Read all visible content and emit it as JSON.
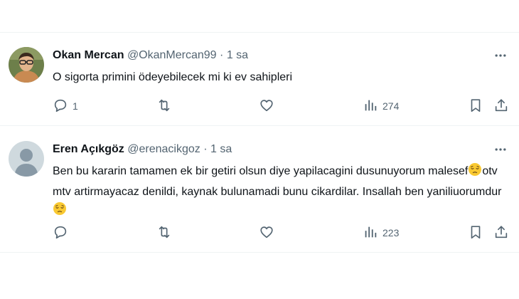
{
  "tweets": [
    {
      "name": "Okan Mercan",
      "handle": "@OkanMercan99",
      "dot": "·",
      "time": "1 sa",
      "text": "O sigorta primini ödeyebilecek mi ki ev sahipleri",
      "reply_count": "1",
      "retweet_count": "",
      "like_count": "",
      "views_count": "274"
    },
    {
      "name": "Eren Açıkgöz",
      "handle": "@erenacikgoz",
      "dot": "·",
      "time": "1 sa",
      "text_part1": "Ben bu kararin tamamen ek bir getiri olsun diye yapilacagini dusunuyorum malesef",
      "text_part2": "otv mtv artirmayacaz denildi, kaynak bulunamadi bunu cikardilar. Insallah ben yaniliuorumdur",
      "reply_count": "",
      "retweet_count": "",
      "like_count": "",
      "views_count": "223"
    }
  ],
  "icons": {
    "more": "more-horizontal-icon",
    "reply": "reply-icon",
    "retweet": "retweet-icon",
    "like": "heart-icon",
    "views": "views-chart-icon",
    "bookmark": "bookmark-icon",
    "share": "share-icon",
    "emoji": "pensive-face-emoji"
  },
  "colors": {
    "text": "#0f1419",
    "secondary": "#536471",
    "divider": "#eff3f4",
    "emoji": "#f9c932"
  }
}
